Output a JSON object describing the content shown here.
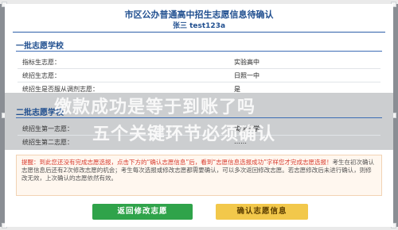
{
  "header": {
    "title": "市区公办普通高中招生志愿信息待确认",
    "subtitle": "张三   test123a"
  },
  "sections": [
    {
      "title": "一批志愿学校",
      "rows": [
        {
          "label": "指标生志愿：",
          "value": "实验高中"
        },
        {
          "label": "统招生志愿：",
          "value": "日照一中"
        },
        {
          "label": "统招生是否服从调剂志愿：",
          "value": "是"
        }
      ]
    },
    {
      "title": "二批志愿学校",
      "rows": [
        {
          "label": "统招生第一志愿：",
          "value": "实验中学"
        },
        {
          "label": "统招生第二志愿：",
          "value": "……"
        }
      ]
    }
  ],
  "watermark": {
    "line1": "缴款成功是等于到账了吗",
    "line2": "五个关键环节必须确认"
  },
  "tip": {
    "prefix": "提醒：",
    "red_text": "到此您还没有完成志愿选报，点击下方的“确认志愿信息”后，看到“志愿信息选报成功”字样您才完成志愿选报！",
    "normal_text": "考生在初次确认志愿信息后还有2次修改志愿的机会；考生每次选报或修改志愿都需要确认，可以多次返回修改志愿。若志愿修改后未进行确认，则修改无效，上次确认的志愿依然有效。"
  },
  "buttons": {
    "back": "返回修改志愿",
    "confirm": "确认志愿信息"
  },
  "colors": {
    "accent_blue": "#1f4e8f",
    "green_button": "#2fa34a",
    "yellow_button": "#f2c84b",
    "tip_red": "#d83c2f"
  }
}
